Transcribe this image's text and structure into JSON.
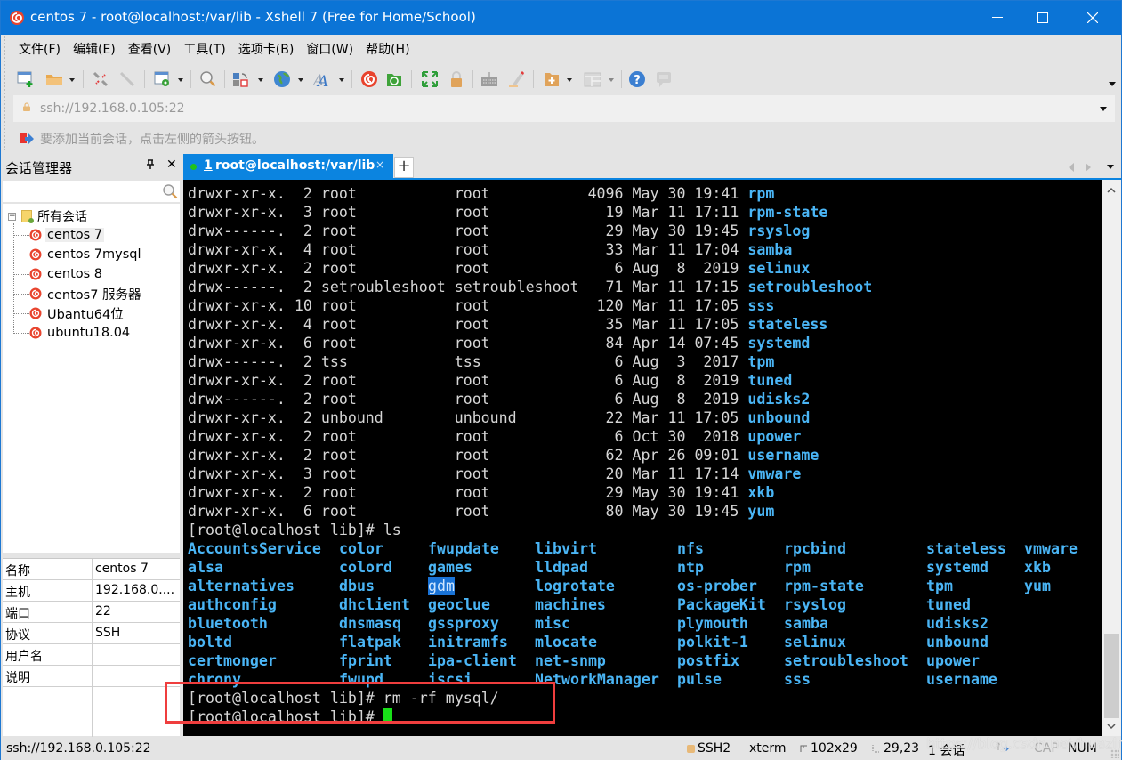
{
  "window": {
    "title": "centos 7 - root@localhost:/var/lib - Xshell 7 (Free for Home/School)",
    "controls": {
      "minimize": "—",
      "maximize": "☐",
      "close": "✕"
    }
  },
  "menu": [
    "文件(F)",
    "编辑(E)",
    "查看(V)",
    "工具(T)",
    "选项卡(B)",
    "窗口(W)",
    "帮助(H)"
  ],
  "toolbar": {
    "icons": [
      "new-session-icon",
      "open-folder-icon",
      "reconnect-icon",
      "disconnect-icon",
      "properties-icon",
      "find-icon",
      "transfer-icon",
      "globe-icon",
      "font-icon",
      "xshell-icon",
      "xftp-icon",
      "fullscreen-icon",
      "lock-icon",
      "keyboard-icon",
      "highlight-icon",
      "new-folder-icon",
      "layout-icon",
      "help-icon",
      "chat-icon"
    ]
  },
  "address": {
    "value": "ssh://192.168.0.105:22"
  },
  "hint": {
    "text": "要添加当前会话，点击左侧的箭头按钮。"
  },
  "session_manager": {
    "title": "会话管理器",
    "pin": "ㅁ",
    "close": "✕",
    "search_placeholder": "",
    "root_label": "所有会话",
    "sessions": [
      {
        "label": "centos 7",
        "selected": true
      },
      {
        "label": "centos 7mysql",
        "selected": false
      },
      {
        "label": "centos 8",
        "selected": false
      },
      {
        "label": "centos7 服务器",
        "selected": false
      },
      {
        "label": "Ubantu64位",
        "selected": false
      },
      {
        "label": "ubuntu18.04",
        "selected": false
      }
    ],
    "properties": [
      {
        "key": "名称",
        "value": "centos 7"
      },
      {
        "key": "主机",
        "value": "192.168.0...."
      },
      {
        "key": "端口",
        "value": "22"
      },
      {
        "key": "协议",
        "value": "SSH"
      },
      {
        "key": "用户名",
        "value": ""
      },
      {
        "key": "说明",
        "value": ""
      }
    ]
  },
  "tabs": [
    {
      "num": "1",
      "label": "root@localhost:/var/lib",
      "close": "×",
      "active": true
    }
  ],
  "tab_add": "+",
  "terminal": {
    "ll_rows": [
      {
        "perm": "drwxr-xr-x.",
        "links": "2",
        "owner": "root",
        "group": "root",
        "size": "4096",
        "date": "May 30 19:41",
        "name": "rpm"
      },
      {
        "perm": "drwxr-xr-x.",
        "links": "3",
        "owner": "root",
        "group": "root",
        "size": "19",
        "date": "Mar 11 17:11",
        "name": "rpm-state"
      },
      {
        "perm": "drwx------.",
        "links": "2",
        "owner": "root",
        "group": "root",
        "size": "29",
        "date": "May 30 19:45",
        "name": "rsyslog"
      },
      {
        "perm": "drwxr-xr-x.",
        "links": "4",
        "owner": "root",
        "group": "root",
        "size": "33",
        "date": "Mar 11 17:04",
        "name": "samba"
      },
      {
        "perm": "drwxr-xr-x.",
        "links": "2",
        "owner": "root",
        "group": "root",
        "size": "6",
        "date": "Aug  8  2019",
        "name": "selinux"
      },
      {
        "perm": "drwx------.",
        "links": "2",
        "owner": "setroubleshoot",
        "group": "setroubleshoot",
        "size": "71",
        "date": "Mar 11 17:15",
        "name": "setroubleshoot"
      },
      {
        "perm": "drwxr-xr-x.",
        "links": "10",
        "owner": "root",
        "group": "root",
        "size": "120",
        "date": "Mar 11 17:05",
        "name": "sss"
      },
      {
        "perm": "drwxr-xr-x.",
        "links": "4",
        "owner": "root",
        "group": "root",
        "size": "35",
        "date": "Mar 11 17:05",
        "name": "stateless"
      },
      {
        "perm": "drwxr-xr-x.",
        "links": "6",
        "owner": "root",
        "group": "root",
        "size": "84",
        "date": "Apr 14 07:45",
        "name": "systemd"
      },
      {
        "perm": "drwx------.",
        "links": "2",
        "owner": "tss",
        "group": "tss",
        "size": "6",
        "date": "Aug  3  2017",
        "name": "tpm"
      },
      {
        "perm": "drwxr-xr-x.",
        "links": "2",
        "owner": "root",
        "group": "root",
        "size": "6",
        "date": "Aug  8  2019",
        "name": "tuned"
      },
      {
        "perm": "drwx------.",
        "links": "2",
        "owner": "root",
        "group": "root",
        "size": "6",
        "date": "Aug  8  2019",
        "name": "udisks2"
      },
      {
        "perm": "drwxr-xr-x.",
        "links": "2",
        "owner": "unbound",
        "group": "unbound",
        "size": "22",
        "date": "Mar 11 17:05",
        "name": "unbound"
      },
      {
        "perm": "drwxr-xr-x.",
        "links": "2",
        "owner": "root",
        "group": "root",
        "size": "6",
        "date": "Oct 30  2018",
        "name": "upower"
      },
      {
        "perm": "drwxr-xr-x.",
        "links": "2",
        "owner": "root",
        "group": "root",
        "size": "62",
        "date": "Apr 26 09:01",
        "name": "username"
      },
      {
        "perm": "drwxr-xr-x.",
        "links": "3",
        "owner": "root",
        "group": "root",
        "size": "20",
        "date": "Mar 11 17:14",
        "name": "vmware"
      },
      {
        "perm": "drwxr-xr-x.",
        "links": "2",
        "owner": "root",
        "group": "root",
        "size": "29",
        "date": "May 30 19:41",
        "name": "xkb"
      },
      {
        "perm": "drwxr-xr-x.",
        "links": "6",
        "owner": "root",
        "group": "root",
        "size": "80",
        "date": "May 30 19:45",
        "name": "yum"
      }
    ],
    "prompt": "[root@localhost lib]# ",
    "ls_command": "ls",
    "ls_columns": [
      [
        "AccountsService",
        "alsa",
        "alternatives",
        "authconfig",
        "bluetooth",
        "boltd",
        "certmonger",
        "chrony"
      ],
      [
        "color",
        "colord",
        "dbus",
        "dhclient",
        "dnsmasq",
        "flatpak",
        "fprint",
        "fwupd"
      ],
      [
        "fwupdate",
        "games",
        "gdm",
        "geoclue",
        "gssproxy",
        "initramfs",
        "ipa-client",
        "iscsi"
      ],
      [
        "libvirt",
        "lldpad",
        "logrotate",
        "machines",
        "misc",
        "mlocate",
        "net-snmp",
        "NetworkManager"
      ],
      [
        "nfs",
        "ntp",
        "os-prober",
        "PackageKit",
        "plymouth",
        "polkit-1",
        "postfix",
        "pulse"
      ],
      [
        "rpcbind",
        "rpm",
        "rpm-state",
        "rsyslog",
        "samba",
        "selinux",
        "setroubleshoot",
        "sss"
      ],
      [
        "stateless",
        "systemd",
        "tpm",
        "tuned",
        "udisks2",
        "unbound",
        "upower",
        "username"
      ],
      [
        "vmware",
        "xkb",
        "yum"
      ]
    ],
    "highlighted_entry": "gdm",
    "rm_command": "rm -rf mysql/"
  },
  "statusbar": {
    "address": "ssh://192.168.0.105:22",
    "protocol": "SSH2",
    "term_type": "xterm",
    "size": "102x29",
    "cursor_pos": "29,23",
    "sessions": "1 会话",
    "cap": "CAP",
    "num": "NUM"
  },
  "watermark": "https://blog.csdn.net/huaziran",
  "colors": {
    "titlebar": "#0b74d6",
    "tab_active": "#0b84e0",
    "terminal_bg": "#000000",
    "terminal_fg": "#d6d6d6",
    "directory": "#4ab5f5",
    "cursor": "#18e018",
    "annotation_box": "#ef3e3e"
  }
}
